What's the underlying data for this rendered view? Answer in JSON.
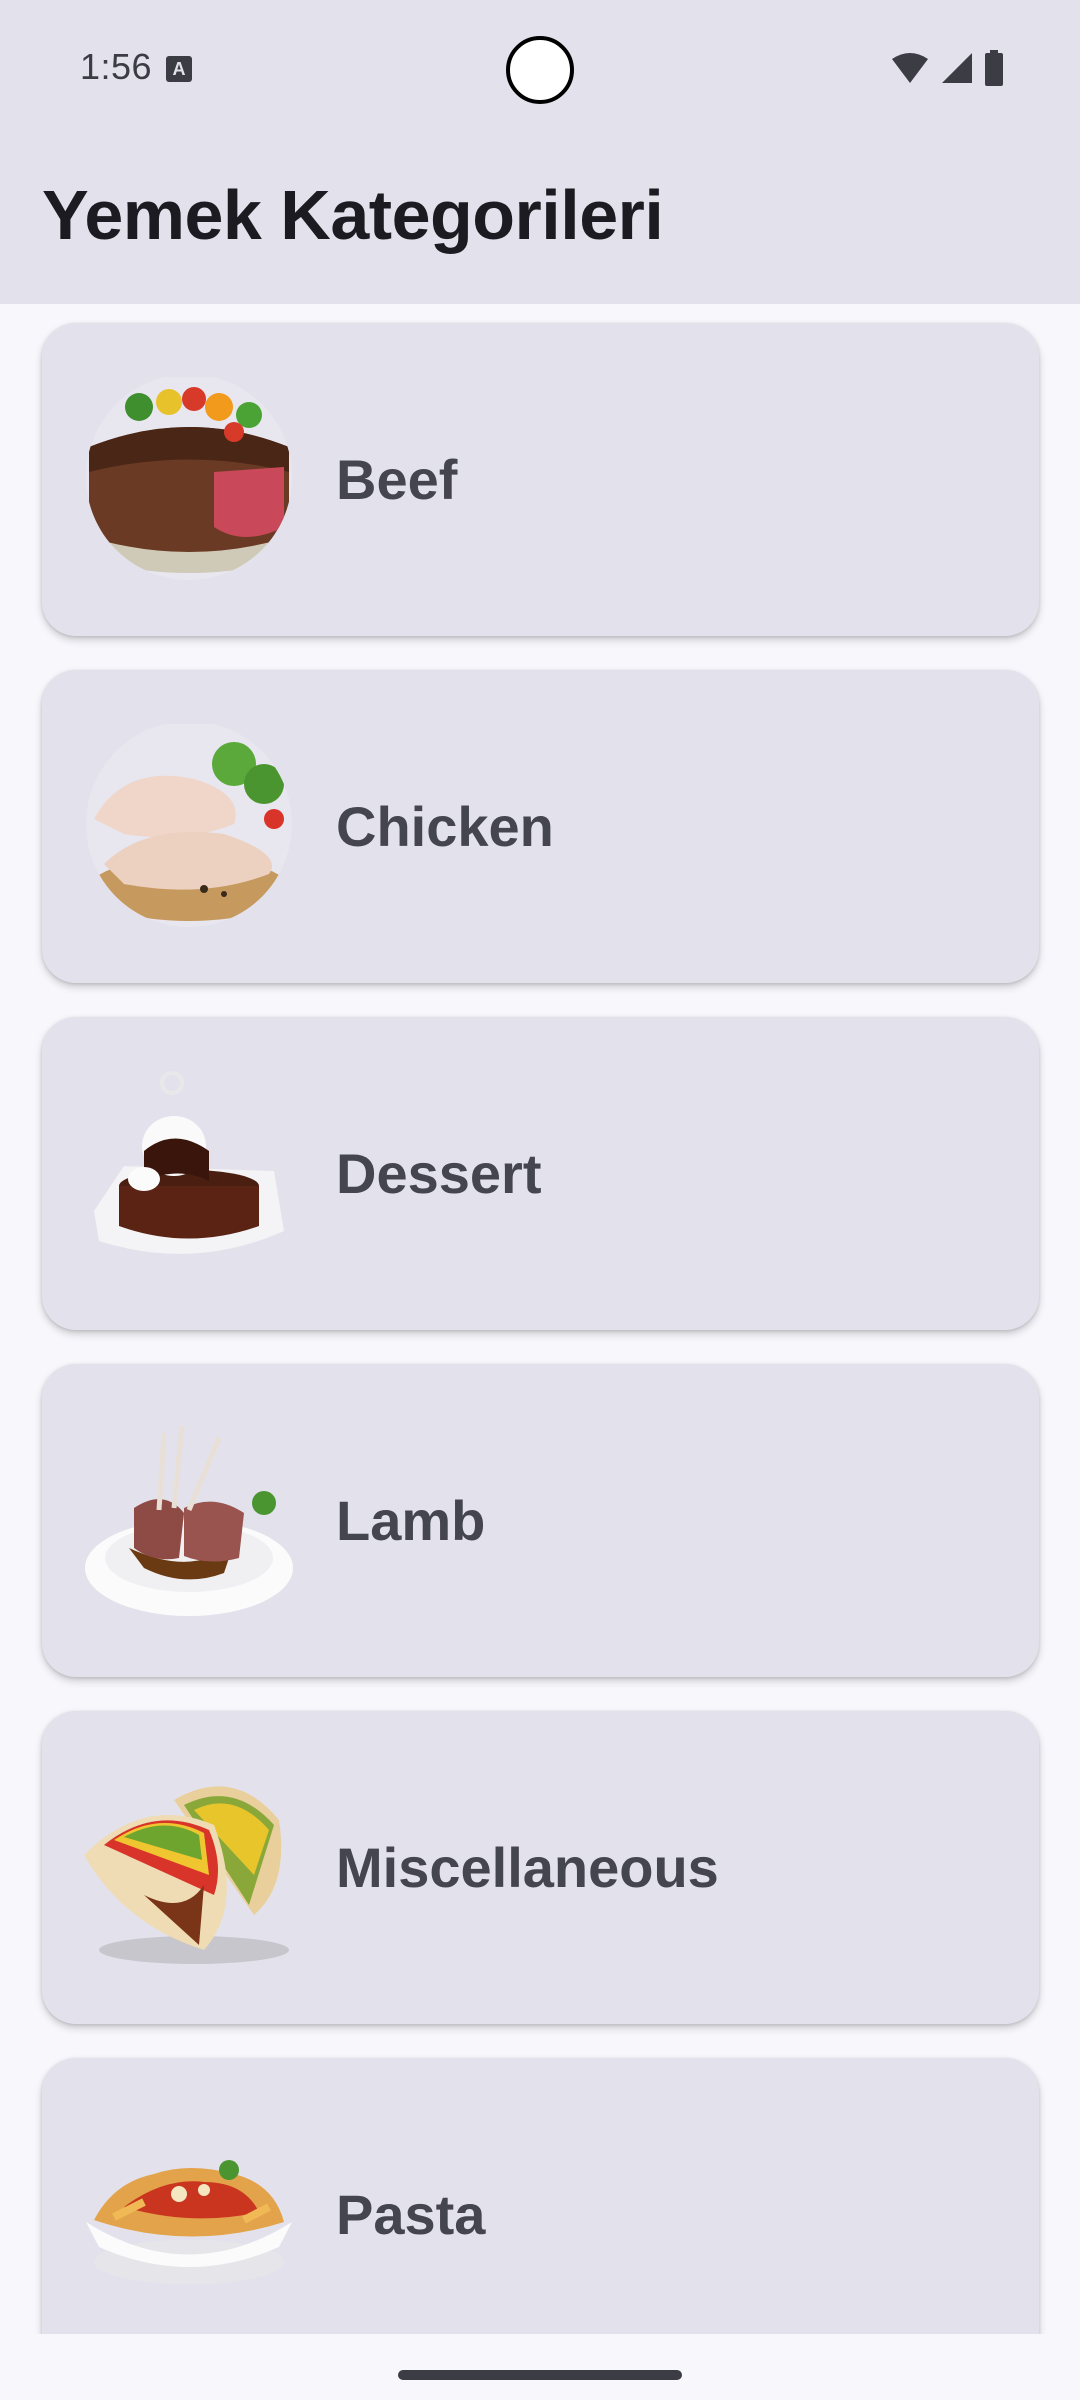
{
  "status_bar": {
    "time": "1:56",
    "notification_icon": "a-icon",
    "wifi_icon": "wifi-icon",
    "signal_icon": "signal-icon",
    "battery_icon": "battery-icon"
  },
  "app_bar": {
    "title": "Yemek Kategorileri"
  },
  "categories": [
    {
      "label": "Beef",
      "icon": "beef-image"
    },
    {
      "label": "Chicken",
      "icon": "chicken-image"
    },
    {
      "label": "Dessert",
      "icon": "dessert-image"
    },
    {
      "label": "Lamb",
      "icon": "lamb-image"
    },
    {
      "label": "Miscellaneous",
      "icon": "miscellaneous-image"
    },
    {
      "label": "Pasta",
      "icon": "pasta-image"
    }
  ],
  "colors": {
    "surface": "#e3e2ec",
    "background": "#f8f7fc",
    "title_text": "#1b1b21",
    "label_text": "#45454f"
  }
}
